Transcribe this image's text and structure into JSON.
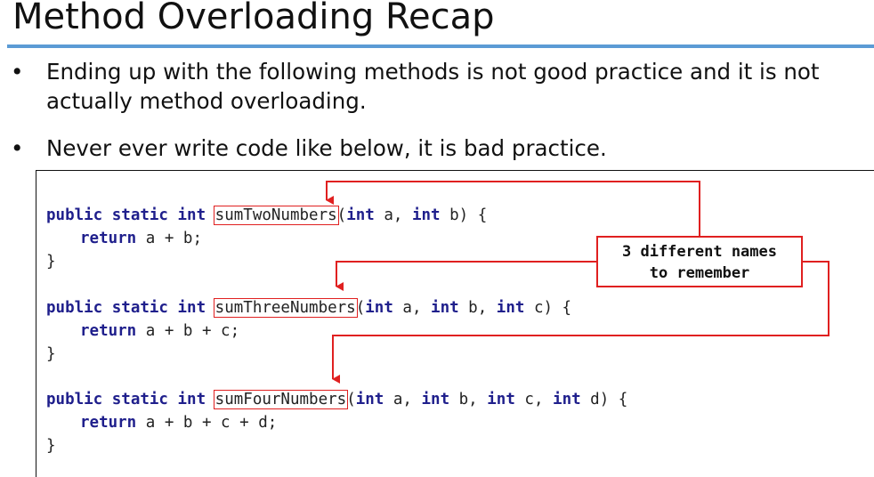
{
  "slide": {
    "title": "Method Overloading Recap",
    "bullets": [
      "Ending up with the following methods is not good practice and it is not actually method overloading.",
      "Never ever write code like below, it is bad practice."
    ],
    "bullet_marker": "•"
  },
  "code": {
    "methods": [
      {
        "modifiers": "public static int",
        "name": "sumTwoNumbers",
        "params_open": "(",
        "params": "int a, int b) {",
        "body_keyword": "return",
        "body_expr": "a + b;",
        "close": "}"
      },
      {
        "modifiers": "public static int",
        "name": "sumThreeNumbers",
        "params": "int a, int b, int c) {",
        "body_keyword": "return",
        "body_expr": "a + b + c;",
        "close": "}"
      },
      {
        "modifiers": "public static int",
        "name": "sumFourNumbers",
        "params": "int a, int b, int c, int d) {",
        "body_keyword": "return",
        "body_expr": "a + b + c + d;",
        "close": "}"
      }
    ]
  },
  "callout": {
    "line1": "3 different names",
    "line2": "to remember"
  },
  "colors": {
    "accent_rule": "#5b9bd5",
    "keyword": "#1f1f8c",
    "highlight": "#e02020"
  }
}
